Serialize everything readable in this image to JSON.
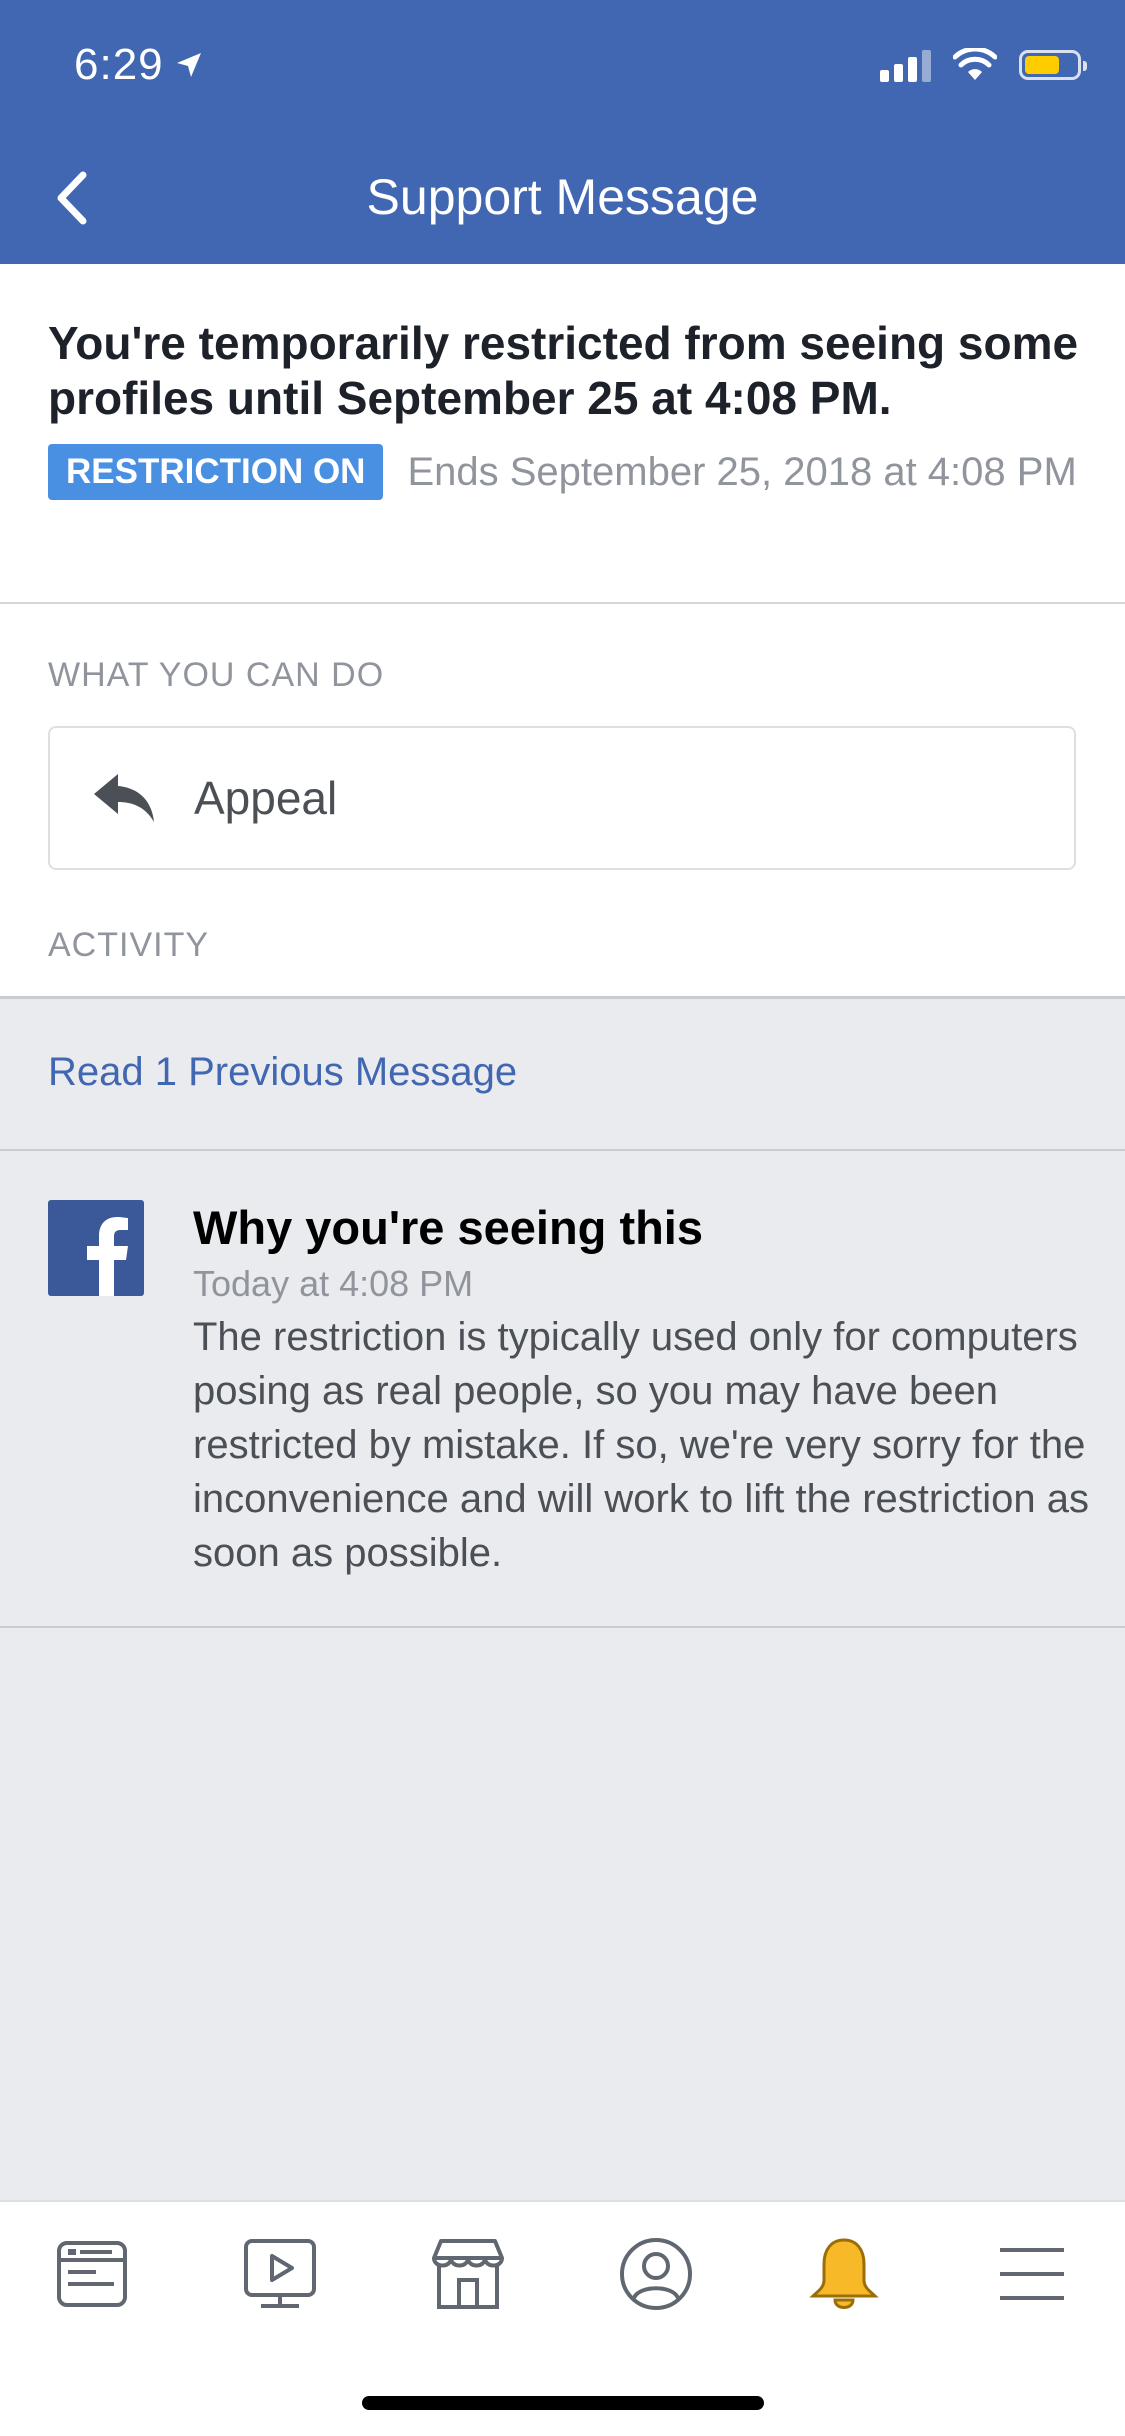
{
  "status_bar": {
    "time": "6:29"
  },
  "header": {
    "title": "Support Message"
  },
  "restriction": {
    "headline": "You're temporarily restricted from seeing some profiles until September 25 at 4:08 PM.",
    "badge": "RESTRICTION ON",
    "ends_text": "Ends September 25, 2018 at 4:08 PM"
  },
  "actions": {
    "section_label": "WHAT YOU CAN DO",
    "appeal_label": "Appeal"
  },
  "activity": {
    "section_label": "ACTIVITY",
    "read_previous": "Read 1 Previous Message",
    "message": {
      "title": "Why you're seeing this",
      "time": "Today at 4:08 PM",
      "body": "The restriction is typically used only for computers posing as real people, so you may have been restricted by mistake. If so, we're very sorry for the inconvenience and will work to lift the restriction as soon as possible."
    }
  },
  "tabbar": {
    "items": [
      {
        "icon": "news-feed-icon"
      },
      {
        "icon": "watch-icon"
      },
      {
        "icon": "marketplace-icon"
      },
      {
        "icon": "profile-icon"
      },
      {
        "icon": "notifications-bell-icon"
      },
      {
        "icon": "menu-icon"
      }
    ],
    "active_color": "#f7b928"
  },
  "colors": {
    "header_bg": "#4267b2",
    "badge_bg": "#4a90e2",
    "link": "#4267b2",
    "battery": "#ffcc00"
  }
}
